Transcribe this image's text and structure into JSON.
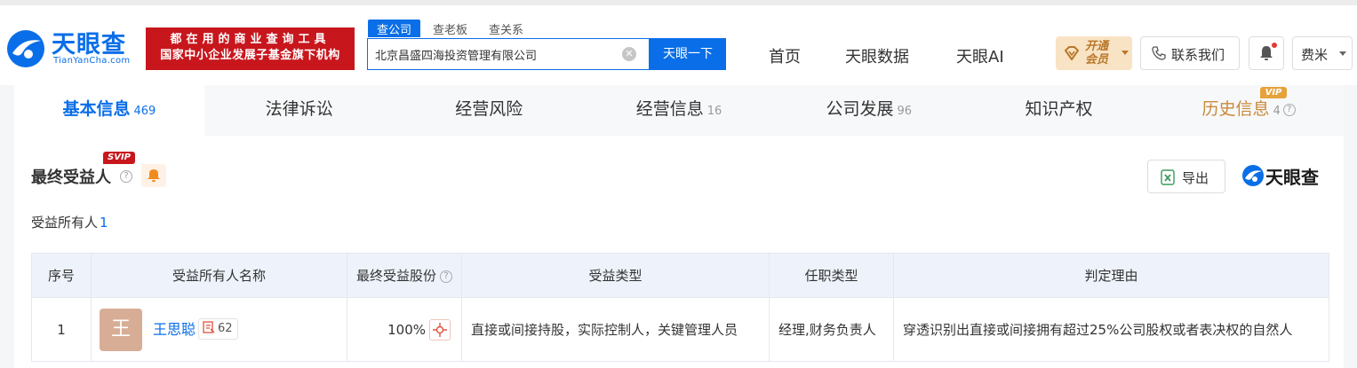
{
  "header": {
    "logo_text": "天眼查",
    "logo_sub": "TianYanCha.com",
    "slogan_line1": "都在用的商业查询工具",
    "slogan_line2": "国家中小企业发展子基金旗下机构",
    "search_tabs": [
      "查公司",
      "查老板",
      "查关系"
    ],
    "search_value": "北京昌盛四海投资管理有限公司",
    "search_button": "天眼一下",
    "nav": [
      "首页",
      "天眼数据",
      "天眼AI"
    ],
    "vip_line1": "开通",
    "vip_line2": "会员",
    "contact": "联系我们",
    "user": "费米"
  },
  "tabs": [
    {
      "label": "基本信息",
      "count": "469"
    },
    {
      "label": "法律诉讼",
      "count": ""
    },
    {
      "label": "经营风险",
      "count": ""
    },
    {
      "label": "经营信息",
      "count": "16"
    },
    {
      "label": "公司发展",
      "count": "96"
    },
    {
      "label": "知识产权",
      "count": ""
    },
    {
      "label": "历史信息",
      "count": "4"
    }
  ],
  "tab_vip_tag": "VIP",
  "section": {
    "title": "最终受益人",
    "svip_tag": "SVIP",
    "export": "导出",
    "brand": "天眼查",
    "owner_label": "受益所有人",
    "owner_count": "1"
  },
  "table": {
    "headers": [
      "序号",
      "受益所有人名称",
      "最终受益股份",
      "受益类型",
      "任职类型",
      "判定理由"
    ],
    "rows": [
      {
        "index": "1",
        "avatar_char": "王",
        "name": "王思聪",
        "badge_count": "62",
        "share": "100%",
        "benefit_type": "直接或间接持股，实际控制人，关键管理人员",
        "position": "经理,财务负责人",
        "reason": "穿透识别出直接或间接拥有超过25%公司股权或者表决权的自然人"
      }
    ]
  },
  "colors": {
    "brand_blue": "#0a6ee8",
    "slogan_red": "#c8161d",
    "vip_gold": "#b9772a",
    "history_tab": "#c98a3a"
  }
}
